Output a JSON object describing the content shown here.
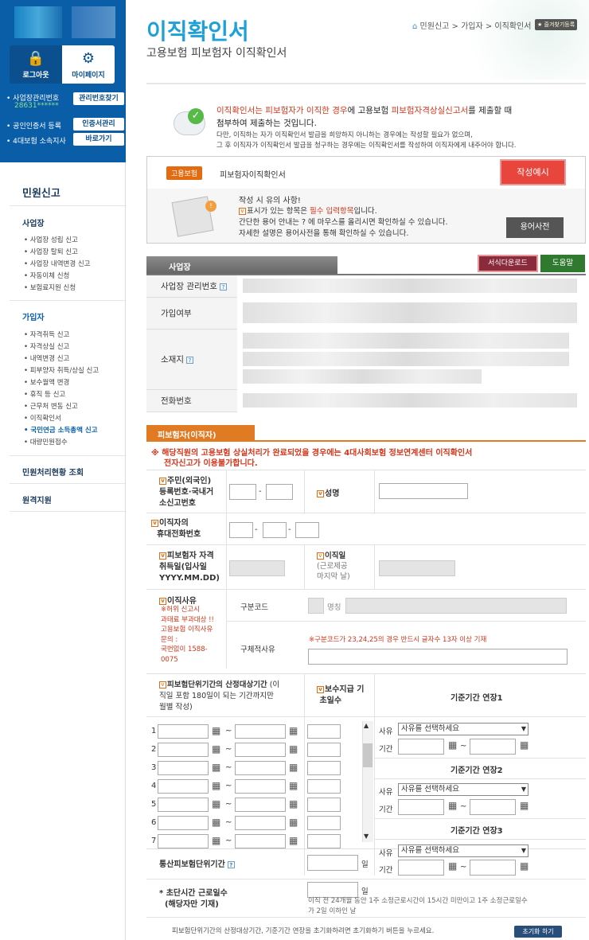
{
  "sidebar": {
    "logout_label": "로그아웃",
    "mypage_label": "마이페이지",
    "biz_no_label": "사업장관리번호",
    "biz_no_value": "28631******",
    "biz_no_btn": "관리번호찾기",
    "cert_label": "공인인증서 등록",
    "cert_btn": "인증서관리",
    "ins4_label": "4대보험 소속지사",
    "ins4_btn": "바로가기",
    "title": "민원신고",
    "sections": [
      {
        "title": "사업장",
        "items": [
          "사업장 성립 신고",
          "사업장 탈퇴 신고",
          "사업장 내역변경 신고",
          "자동이체 신청",
          "보험료지원 신청"
        ]
      },
      {
        "title": "가입자",
        "items": [
          "자격취득 신고",
          "자격상실 신고",
          "내역변경 신고",
          "피부양자 취득/상실 신고",
          "보수월액 변경",
          "휴직 등 신고",
          "근무처 변동 신고",
          "이직확인서",
          "국민연금 소득총액 신고",
          "대량민원접수"
        ]
      }
    ],
    "active_item": "국민연금 소득총액 신고",
    "extra": [
      "민원처리현황 조회",
      "원격지원"
    ]
  },
  "header": {
    "title": "이직확인서",
    "subtitle": "고용보험 피보험자 이직확인서",
    "breadcrumb": "민원신고 > 가입자 > 이직확인서",
    "favorite": "즐겨찾기등록"
  },
  "intro": {
    "p1a": "이직확인서는 피보험자가 이직한 경우",
    "p1b": "에 고용보험 ",
    "p1c": "피보험자격상실신고서",
    "p1d": "를 제출할 때",
    "p2": "첨부하여 제출하는 것입니다.",
    "p3": "다만, 이직하는 자가  이직확인서 발급을 희망하지 아니하는 경우에는 작성할 필요가 없으며,",
    "p4": "그 후 이직자가 이직확인서 발급을 청구하는 경우에는 이직확인서를 작성하여 이직자에게 내주어야 합니다."
  },
  "form_box": {
    "tag": "고용보험",
    "name": "피보험자이직확인서",
    "sample_btn": "작성예시",
    "note_title": "작성 시  유의 사항!",
    "note1a": "표시가 있는 항목은 ",
    "note1b": "필수 입력항목",
    "note1c": "입니다.",
    "note2": "간단한 용어 안내는 ? 에 마우스를 올리시면 확인하실 수 있습니다.",
    "note3": "자세한 설명은 용어사전을 통해 확인하실 수 있습니다.",
    "dict_btn": "용어사전"
  },
  "workplace": {
    "tab": "사업장",
    "download_btn": "서식다운로드",
    "help_btn": "도움말",
    "labels": [
      "사업장 관리번호",
      "가입여부",
      "소재지",
      "전화번호"
    ]
  },
  "insured": {
    "tab": "피보험자(이직자)",
    "warn1": "※ 해당직원의 고용보험 상실처리가 완료되었을 경우에는 4대사회보험 정보연계센터 이직확인서",
    "warn2": "전자신고가 이용불가합니다.",
    "rrn_label1": "주민(외국인)",
    "rrn_label2": "등록번호·국내거",
    "rrn_label3": "소신고번호",
    "name_label": "성명",
    "phone_label1": "이직자의",
    "phone_label2": "휴대전화번호",
    "acq_label1": "피보험자 자격",
    "acq_label2": "취득일(입사일",
    "acq_label3": "YYYY.MM.DD)",
    "leave_label1": "이직일",
    "leave_label2": "(근로제공",
    "leave_label3": "마지막 날)",
    "reason_label": "이직사유",
    "reason_note1": "※허위 신고시",
    "reason_note2": "과태료 부과대상 !!",
    "reason_note3": "고용보험 이직사유",
    "reason_note4": "문의 :",
    "reason_note5": "국번없이 1588-",
    "reason_note6": "0075",
    "code_label": "구분코드",
    "codename_label": "명칭",
    "detail_label": "구체적사유",
    "detail_note": "※구분코드가 23,24,25의 경우 반드시 글자수 13자 이상 기재",
    "period_label1": "피보험단위기간의 산정대상기간",
    "period_label2": " (이",
    "period_label3": "직일 포함 180일이 되는 기간까지만",
    "period_label4": "월별 작성)",
    "pay_label1": "보수지급 기",
    "pay_label2": "초일수",
    "ext1": "기준기간 연장1",
    "ext2": "기준기간 연장2",
    "ext3": "기준기간 연장3",
    "reason_sel_label": "사유",
    "period_sel_label": "기간",
    "select_placeholder": "사유를 선택하세요",
    "rows": [
      "1",
      "2",
      "3",
      "4",
      "5",
      "6",
      "7"
    ],
    "total_label": "통산피보험단위기간",
    "day_unit": "일",
    "short_label1": "* 초단시간 근로일수",
    "short_label2": "(해당자만 기재)",
    "short_note1": "이직 전 24개월 동안 1주 소정근로시간이 15시간 미만이고 1주 소정근로일수",
    "short_note2": "가 2일 이하인 날",
    "reset_note": "피보험단위기간의 산정대상기간, 기준기간 연장을 초기화하려면 초기화하기 버튼을 누르세요.",
    "reset_btn": "초기화 하기"
  }
}
